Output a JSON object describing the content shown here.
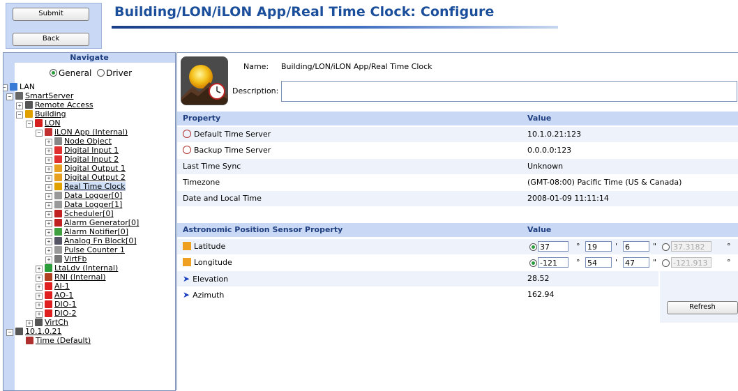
{
  "toolbar": {
    "submit_label": "Submit",
    "back_label": "Back"
  },
  "page": {
    "title": "Building/LON/iLON App/Real Time Clock: Configure"
  },
  "nav": {
    "heading": "Navigate",
    "mode_general": "General",
    "mode_driver": "Driver",
    "mode_selected": "General",
    "tree": [
      {
        "label": "LAN",
        "icon": "network-icon",
        "toggle": "⊟",
        "underline": false
      },
      {
        "label": "SmartServer",
        "icon": "server-icon",
        "toggle": "⊟",
        "underline": true
      },
      {
        "label": "Remote Access",
        "icon": "modem-icon",
        "toggle": "⊞",
        "underline": true
      },
      {
        "label": "Building",
        "icon": "building-icon",
        "toggle": "⊟",
        "underline": true
      },
      {
        "label": "LON",
        "icon": "lon-icon",
        "toggle": "⊟",
        "underline": true
      },
      {
        "label": "iLON App (Internal)",
        "icon": "app-icon",
        "toggle": "⊟",
        "underline": true
      },
      {
        "label": "Node Object",
        "icon": "node-icon",
        "toggle": "⊞",
        "underline": true
      },
      {
        "label": "Digital Input 1",
        "icon": "digital-input-icon",
        "toggle": "⊞",
        "underline": true
      },
      {
        "label": "Digital Input 2",
        "icon": "digital-input-icon",
        "toggle": "⊞",
        "underline": true
      },
      {
        "label": "Digital Output 1",
        "icon": "digital-output-icon",
        "toggle": "⊞",
        "underline": true
      },
      {
        "label": "Digital Output 2",
        "icon": "digital-output-icon",
        "toggle": "⊞",
        "underline": true
      },
      {
        "label": "Real Time Clock",
        "icon": "clock-icon",
        "toggle": "⊞",
        "underline": true,
        "selected": true
      },
      {
        "label": "Data Logger[0]",
        "icon": "logger-icon",
        "toggle": "⊞",
        "underline": true
      },
      {
        "label": "Data Logger[1]",
        "icon": "logger-icon",
        "toggle": "⊞",
        "underline": true
      },
      {
        "label": "Scheduler[0]",
        "icon": "scheduler-icon",
        "toggle": "⊞",
        "underline": true
      },
      {
        "label": "Alarm Generator[0]",
        "icon": "alarm-generator-icon",
        "toggle": "⊞",
        "underline": true
      },
      {
        "label": "Alarm Notifier[0]",
        "icon": "alarm-notifier-icon",
        "toggle": "⊞",
        "underline": true
      },
      {
        "label": "Analog Fn Block[0]",
        "icon": "analog-fn-icon",
        "toggle": "⊞",
        "underline": true
      },
      {
        "label": "Pulse Counter 1",
        "icon": "pulse-counter-icon",
        "toggle": "⊞",
        "underline": true
      },
      {
        "label": "VirtFb",
        "icon": "virtfb-icon",
        "toggle": "⊞",
        "underline": true
      },
      {
        "label": "LtaLdv (Internal)",
        "icon": "ltaldv-icon",
        "toggle": "⊞",
        "underline": true
      },
      {
        "label": "RNI (Internal)",
        "icon": "rni-icon",
        "toggle": "⊞",
        "underline": true
      },
      {
        "label": "AI-1",
        "icon": "io-icon",
        "toggle": "⊞",
        "underline": true
      },
      {
        "label": "AO-1",
        "icon": "io-icon",
        "toggle": "⊞",
        "underline": true
      },
      {
        "label": "DIO-1",
        "icon": "io-icon",
        "toggle": "⊞",
        "underline": true
      },
      {
        "label": "DIO-2",
        "icon": "io-icon",
        "toggle": "⊞",
        "underline": true
      },
      {
        "label": "VirtCh",
        "icon": "virtch-icon",
        "toggle": "⊞",
        "underline": true
      },
      {
        "label": "10.1.0.21",
        "icon": "computer-icon",
        "toggle": "⊟",
        "underline": true
      },
      {
        "label": "Time (Default)",
        "icon": "time-server-icon",
        "toggle": "",
        "underline": true
      }
    ]
  },
  "detail": {
    "name_label": "Name:",
    "name_value": "Building/LON/iLON App/Real Time Clock",
    "description_label": "Description:",
    "description_value": ""
  },
  "properties": {
    "col_property": "Property",
    "col_value": "Value",
    "rows": [
      {
        "label": "Default Time Server",
        "value": "10.1.0.21:123",
        "icon": "time-server-icon"
      },
      {
        "label": "Backup Time Server",
        "value": "0.0.0.0:123",
        "icon": "time-server-icon"
      },
      {
        "label": "Last Time Sync",
        "value": "Unknown",
        "icon": ""
      },
      {
        "label": "Timezone",
        "value": "(GMT-08:00) Pacific Time (US & Canada)",
        "icon": ""
      },
      {
        "label": "Date and Local Time",
        "value": "2008-01-09 11:11:14",
        "icon": ""
      }
    ]
  },
  "astro": {
    "col_property": "Astronomic Position Sensor Property",
    "col_value": "Value",
    "latitude": {
      "label": "Latitude",
      "deg": "37",
      "min": "19",
      "sec": "6",
      "decimal": "37.3182"
    },
    "longitude": {
      "label": "Longitude",
      "deg": "-121",
      "min": "54",
      "sec": "47",
      "decimal": "-121.913"
    },
    "deg_symbol": "°",
    "min_symbol": "'",
    "sec_symbol": "\"",
    "elevation": {
      "label": "Elevation",
      "value": "28.52"
    },
    "azimuth": {
      "label": "Azimuth",
      "value": "162.94"
    },
    "refresh_label": "Refresh"
  },
  "colors": {
    "accent": "#1b4f9c",
    "header_bg": "#c9d8f4",
    "selected_radio": "#2a9d3a"
  }
}
